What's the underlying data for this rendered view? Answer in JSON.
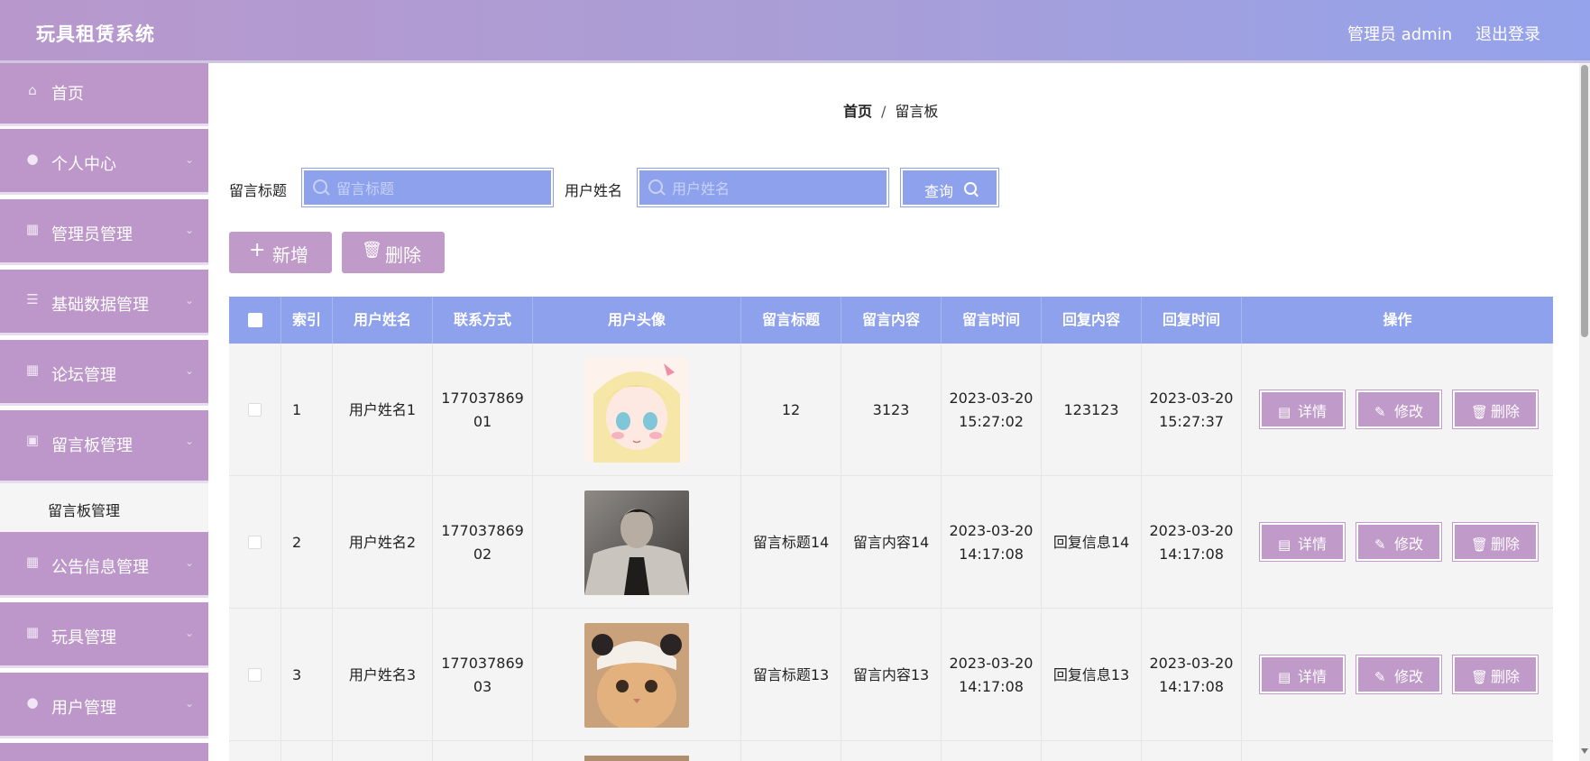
{
  "header": {
    "app_title": "玩具租赁系统",
    "user_info": "管理员 admin",
    "logout_label": "退出登录"
  },
  "sidebar": {
    "items": [
      {
        "label": "首页",
        "icon": "home-icon",
        "glyph": "⌂"
      },
      {
        "label": "个人中心",
        "icon": "user-icon",
        "glyph": "👤"
      },
      {
        "label": "管理员管理",
        "icon": "grid-icon",
        "glyph": "▦"
      },
      {
        "label": "基础数据管理",
        "icon": "sliders-icon",
        "glyph": "☰"
      },
      {
        "label": "论坛管理",
        "icon": "grid-icon",
        "glyph": "▦"
      },
      {
        "label": "留言板管理",
        "icon": "briefcase-icon",
        "glyph": "▣"
      },
      {
        "label": "公告信息管理",
        "icon": "grid-icon",
        "glyph": "▦"
      },
      {
        "label": "玩具管理",
        "icon": "grid-icon",
        "glyph": "▦"
      },
      {
        "label": "用户管理",
        "icon": "user-icon",
        "glyph": "👤"
      }
    ],
    "submenu_active": "留言板管理"
  },
  "breadcrumb": {
    "home": "首页",
    "separator": "/",
    "current": "留言板"
  },
  "search": {
    "title_label": "留言标题",
    "title_placeholder": "留言标题",
    "name_label": "用户姓名",
    "name_placeholder": "用户姓名",
    "query_label": "查询"
  },
  "actions": {
    "add_label": "新增",
    "delete_label": "删除"
  },
  "table": {
    "columns": [
      "索引",
      "用户姓名",
      "联系方式",
      "用户头像",
      "留言标题",
      "留言内容",
      "留言时间",
      "回复内容",
      "回复时间",
      "操作"
    ],
    "rows": [
      {
        "index": "1",
        "name": "用户姓名1",
        "phone_1": "177037869",
        "phone_2": "01",
        "avatar": "anime-girl-avatar",
        "title": "12",
        "content": "3123",
        "time_date": "2023-03-20",
        "time_clock": "15:27:02",
        "reply": "123123",
        "reply_date": "2023-03-20",
        "reply_clock": "15:27:37"
      },
      {
        "index": "2",
        "name": "用户姓名2",
        "phone_1": "177037869",
        "phone_2": "02",
        "avatar": "man-coat-photo",
        "title": "留言标题14",
        "content": "留言内容14",
        "time_date": "2023-03-20",
        "time_clock": "14:17:08",
        "reply": "回复信息14",
        "reply_date": "2023-03-20",
        "reply_clock": "14:17:08"
      },
      {
        "index": "3",
        "name": "用户姓名3",
        "phone_1": "177037869",
        "phone_2": "03",
        "avatar": "cat-hat-photo",
        "title": "留言标题13",
        "content": "留言内容13",
        "time_date": "2023-03-20",
        "time_clock": "14:17:08",
        "reply": "回复信息13",
        "reply_date": "2023-03-20",
        "reply_clock": "14:17:08"
      }
    ],
    "op_labels": {
      "detail": "详情",
      "edit": "修改",
      "delete": "删除"
    }
  },
  "colors": {
    "header_gradient_start": "#b898cc",
    "header_gradient_end": "#94a3ec",
    "sidebar_item": "#bd97c9",
    "accent_blue": "#8ea1ec",
    "button_purple": "#c09ac9"
  }
}
